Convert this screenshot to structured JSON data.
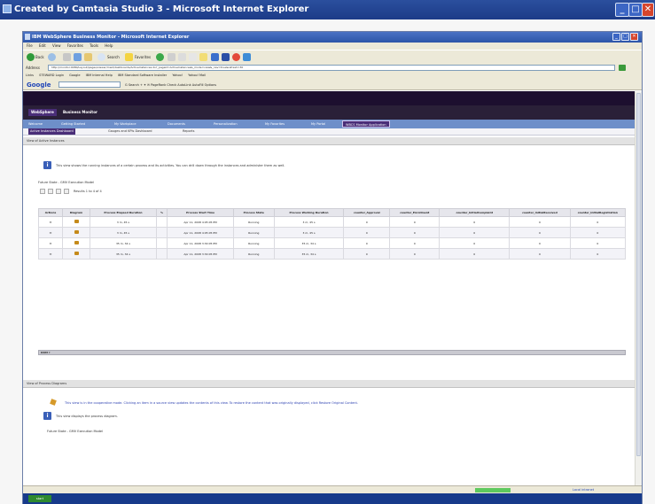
{
  "outer_window": {
    "title": "Created by Camtasia Studio 3 - Microsoft Internet Explorer",
    "min": "_",
    "max": "□",
    "close": "✕"
  },
  "inner_window": {
    "title": "IBM WebSphere Business Monitor - Microsoft Internet Explorer",
    "menu": [
      "File",
      "Edit",
      "View",
      "Favorites",
      "Tools",
      "Help"
    ],
    "back_label": "Back",
    "search_label": "Search",
    "favorites_label": "Favorites",
    "address_label": "Address",
    "address_value": "http://monitor:9080/Layout/pages/viewer/mwd/dashboards/ActiveInstances.do?_pageid=ActiveInstances&_mode=view&_nav=true&refresh=30",
    "links": [
      "Links",
      "STEWARD Login",
      "Google",
      "IBM Internal Help",
      "IBM Standard Software Installer",
      "Yahoo!",
      "Yahoo! Mail"
    ],
    "google_label": "Google",
    "google_tools": "G Search  +  ✦  ✉  PageRank  Check  AutoLink  AutoFill  Options"
  },
  "app": {
    "brand": "WebSphere",
    "name": "Business Monitor",
    "nav_tabs": [
      "Welcome",
      "Getting Started",
      "My Workplace",
      "Documents",
      "Personalization",
      "My Favorites",
      "My Portal",
      "WBCS Monitor Application"
    ],
    "sub_tabs": [
      "Active Instances Dashboard",
      "Gauges and KPIs Dashboard",
      "Reports"
    ]
  },
  "instances_section": {
    "title": "View of Active Instances",
    "info_text": "This view shows the running instances of a certain process and its activities. You can drill down through the instances and administer them as well.",
    "future_state": "Future State - GMV Execution Model",
    "result_text": "Results 1 to 4 of 4",
    "columns": [
      "Actions",
      "Diagram",
      "Process Elapsed Duration",
      "%",
      "Process Start Time",
      "Process State",
      "Process Working Duration",
      "counter_Approval",
      "counter_Enrollment",
      "counter_InitialComplaint",
      "counter_InitialReceived",
      "counter_InitialRegistration"
    ],
    "rows": [
      [
        "✉",
        "",
        "3 m, 45 s",
        "",
        "Apr 11, 2008 4:05:05 PM",
        "Running",
        "3 m, 45 s",
        "0",
        "0",
        "0",
        "0",
        "0"
      ],
      [
        "✉",
        "",
        "3 m, 45 s",
        "",
        "Apr 11, 2008 4:05:05 PM",
        "Running",
        "3 m, 45 s",
        "0",
        "0",
        "0",
        "0",
        "0"
      ],
      [
        "✉",
        "",
        "35 m, 34 s",
        "",
        "Apr 11, 2008 3:30:05 PM",
        "Running",
        "35 m, 34 s",
        "0",
        "0",
        "0",
        "0",
        "0"
      ],
      [
        "✉",
        "",
        "35 m, 34 s",
        "",
        "Apr 11, 2008 3:30:05 PM",
        "Running",
        "35 m, 34 s",
        "0",
        "0",
        "0",
        "0",
        "0"
      ]
    ],
    "scroll_label": "DDM ▾"
  },
  "diagram_section": {
    "title": "View of Process Diagrams",
    "link_text": "This view is in the cooperative mode. Clicking an item in a source view updates the contents of this view. To restore the content that was originally displayed, click Restore Original Content.",
    "info_text": "This view displays the process diagram.",
    "future_state": "Future State - GMV Execution Model"
  },
  "status": {
    "zone": "Local intranet",
    "start": "start",
    "progress": 0.5
  }
}
